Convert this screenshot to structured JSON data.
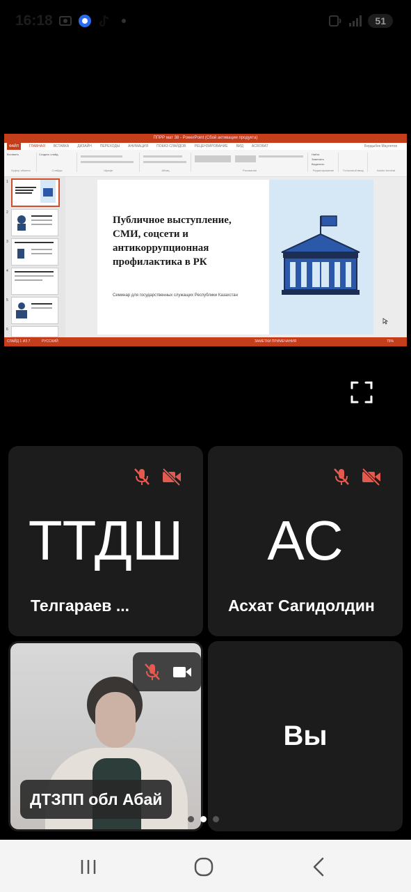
{
  "status_bar": {
    "time": "16:18",
    "battery": "51",
    "left_icons": [
      "screen-record-icon",
      "messenger-icon",
      "tiktok-icon",
      "dot-icon"
    ],
    "right_icons": [
      "vowifi-icon",
      "signal-icon"
    ]
  },
  "screen_share": {
    "ppt_title": "ППРР мат 38 - PowerPoint (Сбой активации продукта)",
    "ppt_tabs": [
      "ФАЙЛ",
      "ГЛАВНАЯ",
      "ВСТАВКА",
      "ДИЗАЙН",
      "ПЕРЕХОДЫ",
      "АНИМАЦИЯ",
      "ПОКАЗ СЛАЙДОВ",
      "РЕЦЕНЗИРОВАНИЕ",
      "ВИД",
      "ACROBAT"
    ],
    "ribbon_groups": [
      "Буфер обмена",
      "Слайды",
      "Шрифт",
      "Абзац",
      "Рисование",
      "Редактирование",
      "Голосовой ввод",
      "Adobe Acrobat"
    ],
    "ribbon_buttons": [
      "Вставить",
      "Создать слайд",
      "Найти",
      "Заменить",
      "Выделить"
    ],
    "ppt_user": "Бердыбек Маулетов",
    "slide_numbers": [
      "1",
      "2",
      "3",
      "4",
      "5",
      "6"
    ],
    "slide_title": "Публичное выступление, СМИ, соцсети и антикоррупционная профилактика в РК",
    "slide_subtitle": "Семинар для государственных служащих Республики Казахстан",
    "ppt_status_left": "СЛАЙД 1 ИЗ 7",
    "ppt_status_lang": "РУССКИЙ",
    "ppt_status_right": "ЗАМЕТКИ   ПРИМЕЧАНИЯ",
    "ppt_zoom": "75%"
  },
  "participants": [
    {
      "initials": "ТТДШ",
      "name": "Телгараев ...",
      "mic": "muted",
      "video": "off"
    },
    {
      "initials": "АС",
      "name": "Асхат Сагидолдин",
      "mic": "muted",
      "video": "off"
    },
    {
      "name": "ДТЗПП обл Абай",
      "mic": "muted",
      "video": "on"
    },
    {
      "label": "Вы"
    }
  ],
  "colors": {
    "accent_red": "#e55a4e",
    "ppt_red": "#c43e1c",
    "tile_bg": "#1c1c1c"
  },
  "pager": {
    "pages": 3,
    "active_page": 2
  }
}
